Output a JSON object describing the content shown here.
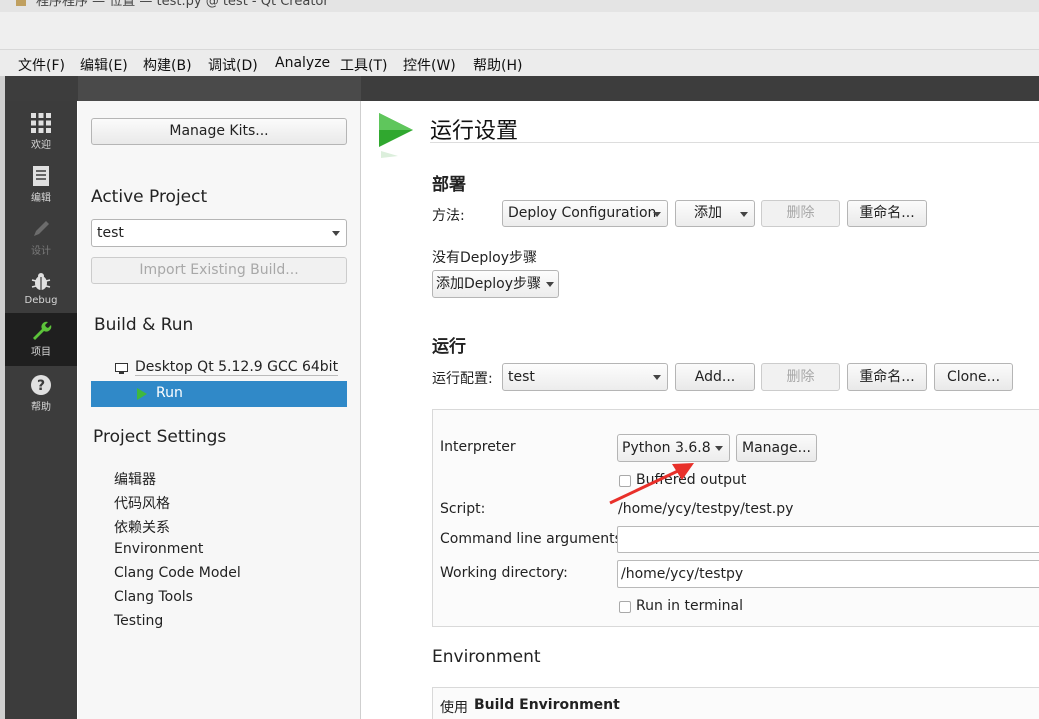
{
  "window": {
    "title": "程序程序 — 位置 — test.py @ test - Qt Creator"
  },
  "menu": [
    {
      "label": "文件(F)"
    },
    {
      "label": "编辑(E)"
    },
    {
      "label": "构建(B)"
    },
    {
      "label": "调试(D)"
    },
    {
      "label": "Analyze"
    },
    {
      "label": "工具(T)"
    },
    {
      "label": "控件(W)"
    },
    {
      "label": "帮助(H)"
    }
  ],
  "modes": [
    {
      "label": "欢迎",
      "icon": "grid-icon"
    },
    {
      "label": "编辑",
      "icon": "document-icon"
    },
    {
      "label": "设计",
      "icon": "pencil-icon"
    },
    {
      "label": "Debug",
      "icon": "bug-icon"
    },
    {
      "label": "项目",
      "icon": "wrench-icon"
    },
    {
      "label": "帮助",
      "icon": "help-icon"
    }
  ],
  "sidebar": {
    "manage_kits": "Manage Kits...",
    "active_project_heading": "Active Project",
    "active_project_value": "test",
    "import_build": "Import Existing Build...",
    "build_run_heading": "Build & Run",
    "kit_name": "Desktop Qt 5.12.9 GCC 64bit",
    "run_item": "Run",
    "project_settings_heading": "Project Settings",
    "settings_items": [
      "编辑器",
      "代码风格",
      "依赖关系",
      "Environment",
      "Clang Code Model",
      "Clang Tools",
      "Testing"
    ]
  },
  "main": {
    "title": "运行设置",
    "deploy": {
      "heading": "部署",
      "method_label": "方法:",
      "config_value": "Deploy Configuration",
      "add": "添加",
      "remove": "删除",
      "rename": "重命名...",
      "no_steps": "没有Deploy步骤",
      "add_step": "添加Deploy步骤"
    },
    "run": {
      "heading": "运行",
      "config_label": "运行配置:",
      "config_value": "test",
      "add": "Add...",
      "remove": "删除",
      "rename": "重命名...",
      "clone": "Clone...",
      "interpreter_label": "Interpreter",
      "interpreter_value": "Python 3.6.8",
      "manage": "Manage...",
      "buffered_output": "Buffered output",
      "buffered_checked": false,
      "script_label": "Script:",
      "script_value": "/home/ycy/testpy/test.py",
      "args_label": "Command line arguments:",
      "args_value": "",
      "workdir_label": "Working directory:",
      "workdir_value": "/home/ycy/testpy",
      "run_in_terminal": "Run in terminal",
      "run_in_terminal_checked": false
    },
    "environment": {
      "heading": "Environment",
      "use_prefix": "使用",
      "use_value": "Build Environment"
    }
  },
  "colors": {
    "accent": "#3089c8",
    "run_green": "#2ea82e",
    "annotation_arrow": "#e8302a"
  }
}
